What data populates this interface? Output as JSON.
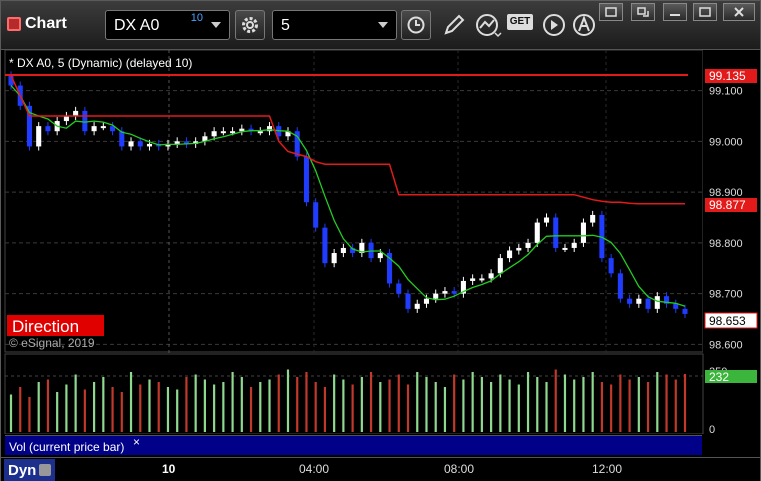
{
  "toolbar": {
    "title": "Chart",
    "symbol": "DX A0",
    "symbol_links": "10",
    "interval": "5",
    "icons": [
      "settings-gear-icon",
      "clock-icon",
      "pencil-icon",
      "line-study-icon",
      "get-icon",
      "play-icon",
      "alert-icon"
    ],
    "get_label": "GET"
  },
  "chart": {
    "header": "* DX A0, 5 (Dynamic) (delayed 10)",
    "direction_label": "Direction",
    "copyright": "© eSignal, 2019",
    "price_axis": [
      "99.100",
      "99.000",
      "98.900",
      "98.800",
      "98.700",
      "98.600"
    ],
    "flag_high": "99.135",
    "flag_stop": "98.877",
    "flag_last": "98.653",
    "colors": {
      "stop_line": "#e21a1a",
      "up_candle": "#ffffff",
      "down_candle": "#1f3cff",
      "ma": "#22cc22",
      "vol_up": "#8fd88f",
      "vol_down": "#c0392b"
    }
  },
  "volume": {
    "label": "Vol (current price bar)",
    "close_glyph": "×",
    "axis_top": "250",
    "axis_zero": "0",
    "flag_value": "232"
  },
  "bottom": {
    "mode": "Dyn",
    "time_labels": [
      "10",
      "04:00",
      "08:00",
      "12:00"
    ]
  },
  "chart_data": {
    "type": "candlestick",
    "ylim": [
      98.585,
      99.18
    ],
    "close": [
      99.11,
      99.07,
      98.99,
      99.03,
      99.02,
      99.04,
      99.05,
      99.06,
      99.02,
      99.03,
      99.03,
      99.02,
      98.99,
      99.0,
      98.99,
      98.995,
      98.99,
      98.995,
      99.0,
      98.995,
      99.0,
      99.01,
      99.02,
      99.02,
      99.02,
      99.025,
      99.02,
      99.02,
      99.03,
      99.01,
      99.02,
      98.97,
      98.88,
      98.83,
      98.76,
      98.78,
      98.79,
      98.78,
      98.8,
      98.77,
      98.78,
      98.72,
      98.7,
      98.67,
      98.68,
      98.69,
      98.7,
      98.705,
      98.7,
      98.725,
      98.73,
      98.73,
      98.74,
      98.77,
      98.785,
      98.79,
      98.8,
      98.84,
      98.85,
      98.79,
      98.79,
      98.8,
      98.84,
      98.855,
      98.77,
      98.74,
      98.69,
      98.68,
      98.69,
      98.67,
      98.695,
      98.68,
      98.67,
      98.66
    ],
    "stop_line": [
      99.13,
      99.09,
      99.05,
      99.05,
      99.05,
      99.05,
      99.05,
      99.05,
      99.05,
      99.05,
      99.05,
      99.05,
      99.05,
      99.05,
      99.05,
      99.05,
      99.05,
      99.05,
      99.05,
      99.05,
      99.05,
      99.05,
      99.05,
      99.05,
      99.05,
      99.05,
      99.05,
      99.05,
      99.05,
      99.0,
      98.98,
      98.975,
      98.97,
      98.96,
      98.955,
      98.955,
      98.955,
      98.955,
      98.955,
      98.955,
      98.955,
      98.955,
      98.895,
      98.895,
      98.895,
      98.895,
      98.895,
      98.895,
      98.895,
      98.895,
      98.895,
      98.895,
      98.895,
      98.895,
      98.895,
      98.895,
      98.895,
      98.895,
      98.895,
      98.895,
      98.895,
      98.895,
      98.89,
      98.885,
      98.882,
      98.88,
      98.88,
      98.878,
      98.877,
      98.877,
      98.877,
      98.877,
      98.877,
      98.877
    ],
    "volume": [
      150,
      180,
      140,
      200,
      210,
      160,
      190,
      230,
      170,
      200,
      220,
      180,
      160,
      240,
      190,
      210,
      200,
      180,
      170,
      220,
      230,
      210,
      190,
      200,
      240,
      220,
      180,
      200,
      210,
      230,
      250,
      220,
      240,
      200,
      180,
      230,
      210,
      190,
      220,
      240,
      200,
      210,
      230,
      190,
      240,
      220,
      200,
      180,
      230,
      210,
      240,
      220,
      200,
      230,
      210,
      190,
      240,
      220,
      200,
      250,
      230,
      210,
      220,
      240,
      200,
      190,
      230,
      210,
      220,
      200,
      240,
      230,
      210,
      232
    ]
  }
}
